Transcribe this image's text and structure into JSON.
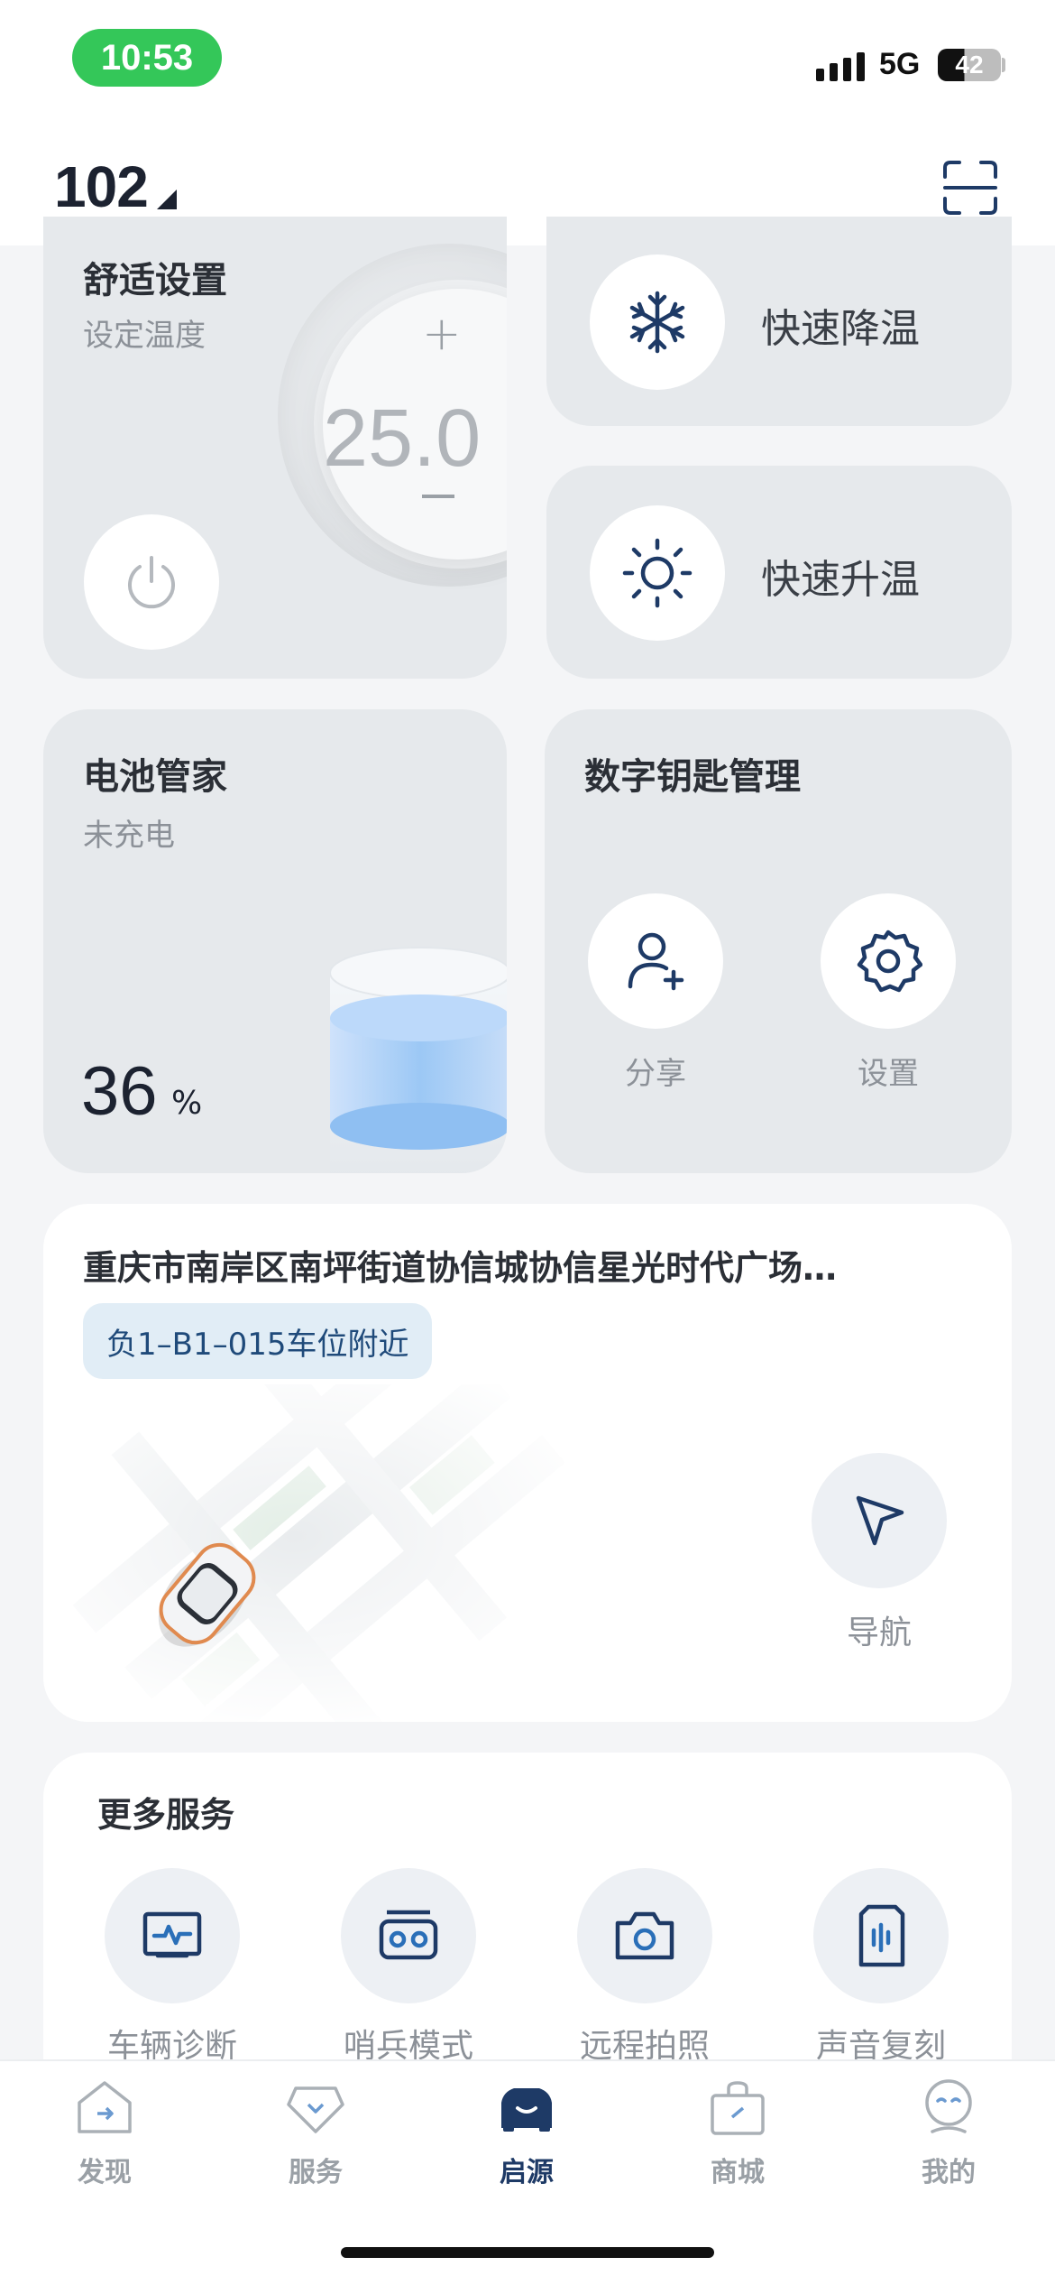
{
  "status_bar": {
    "time": "10:53",
    "network": "5G",
    "battery": "42"
  },
  "header": {
    "car_id": "102"
  },
  "comfort": {
    "title": "舒适设置",
    "subtitle": "设定温度",
    "plus": "+",
    "temperature": "25.0"
  },
  "quick_cool": {
    "label": "快速降温"
  },
  "quick_heat": {
    "label": "快速升温"
  },
  "battery": {
    "title": "电池管家",
    "status": "未充电",
    "percent": "36",
    "unit": "%",
    "level": 0.36
  },
  "digital_key": {
    "title": "数字钥匙管理",
    "share_label": "分享",
    "settings_label": "设置"
  },
  "location": {
    "address": "重庆市南岸区南坪街道协信城协信星光时代广场…",
    "parking_spot": "负1–B1–015车位附近",
    "navigate_label": "导航"
  },
  "more_services": {
    "title": "更多服务",
    "items": [
      {
        "label": "车辆诊断",
        "icon": "diagnostics-icon"
      },
      {
        "label": "哨兵模式",
        "icon": "sentry-icon"
      },
      {
        "label": "远程拍照",
        "icon": "camera-icon"
      },
      {
        "label": "声音复刻",
        "icon": "voice-clone-icon"
      }
    ]
  },
  "tabs": [
    {
      "label": "发现",
      "icon": "discover-icon",
      "active": false
    },
    {
      "label": "服务",
      "icon": "service-icon",
      "active": false
    },
    {
      "label": "启源",
      "icon": "car-icon",
      "active": true
    },
    {
      "label": "商城",
      "icon": "shop-icon",
      "active": false
    },
    {
      "label": "我的",
      "icon": "profile-icon",
      "active": false
    }
  ],
  "colors": {
    "accent": "#1e3a66",
    "card_bg": "#e6e9ec",
    "page_bg": "#f4f5f7",
    "status_pill": "#34c759"
  }
}
